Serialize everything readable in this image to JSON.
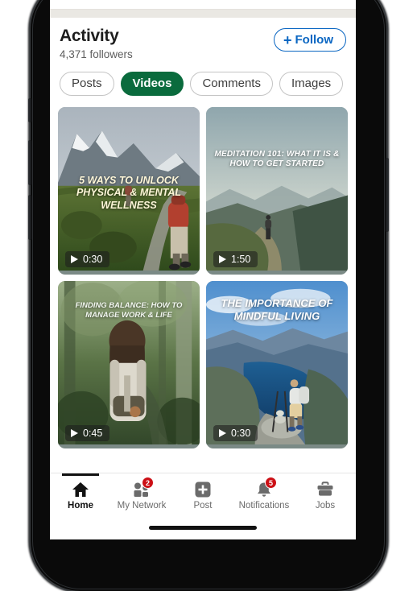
{
  "header": {
    "title": "Activity",
    "followers": "4,371 followers",
    "follow_label": "Follow",
    "follow_plus": "+",
    "accent_blue": "#0a66c2"
  },
  "filters": {
    "active_color": "#0a6b3d",
    "chips": [
      {
        "label": "Posts",
        "active": false
      },
      {
        "label": "Videos",
        "active": true
      },
      {
        "label": "Comments",
        "active": false
      },
      {
        "label": "Images",
        "active": false
      }
    ]
  },
  "videos": [
    {
      "caption": "5 WAYS TO UNLOCK PHYSICAL & MENTAL WELLNESS",
      "duration": "0:30",
      "scene": "hiker with red backpack on green mountain trail, snowy peaks"
    },
    {
      "caption": "MEDITATION 101: WHAT IT IS & HOW TO GET STARTED",
      "duration": "1:50",
      "scene": "lone person walking a ridge trail above hazy blue mountains"
    },
    {
      "caption": "FINDING BALANCE: HOW TO MANAGE WORK & LIFE",
      "duration": "0:45",
      "scene": "woman with white backpack walking in a green forest"
    },
    {
      "caption": "THE IMPORTANCE OF MINDFUL LIVING",
      "duration": "0:30",
      "scene": "hiker on rock above blue fjord lake and cliffs"
    }
  ],
  "bottom_nav": {
    "badge_color": "#cc1016",
    "items": [
      {
        "label": "Home",
        "icon": "home-icon",
        "badge": null,
        "active": true
      },
      {
        "label": "My Network",
        "icon": "people-icon",
        "badge": "2",
        "active": false
      },
      {
        "label": "Post",
        "icon": "plus-square-icon",
        "badge": null,
        "active": false
      },
      {
        "label": "Notifications",
        "icon": "bell-icon",
        "badge": "5",
        "active": false
      },
      {
        "label": "Jobs",
        "icon": "briefcase-icon",
        "badge": null,
        "active": false
      }
    ]
  }
}
